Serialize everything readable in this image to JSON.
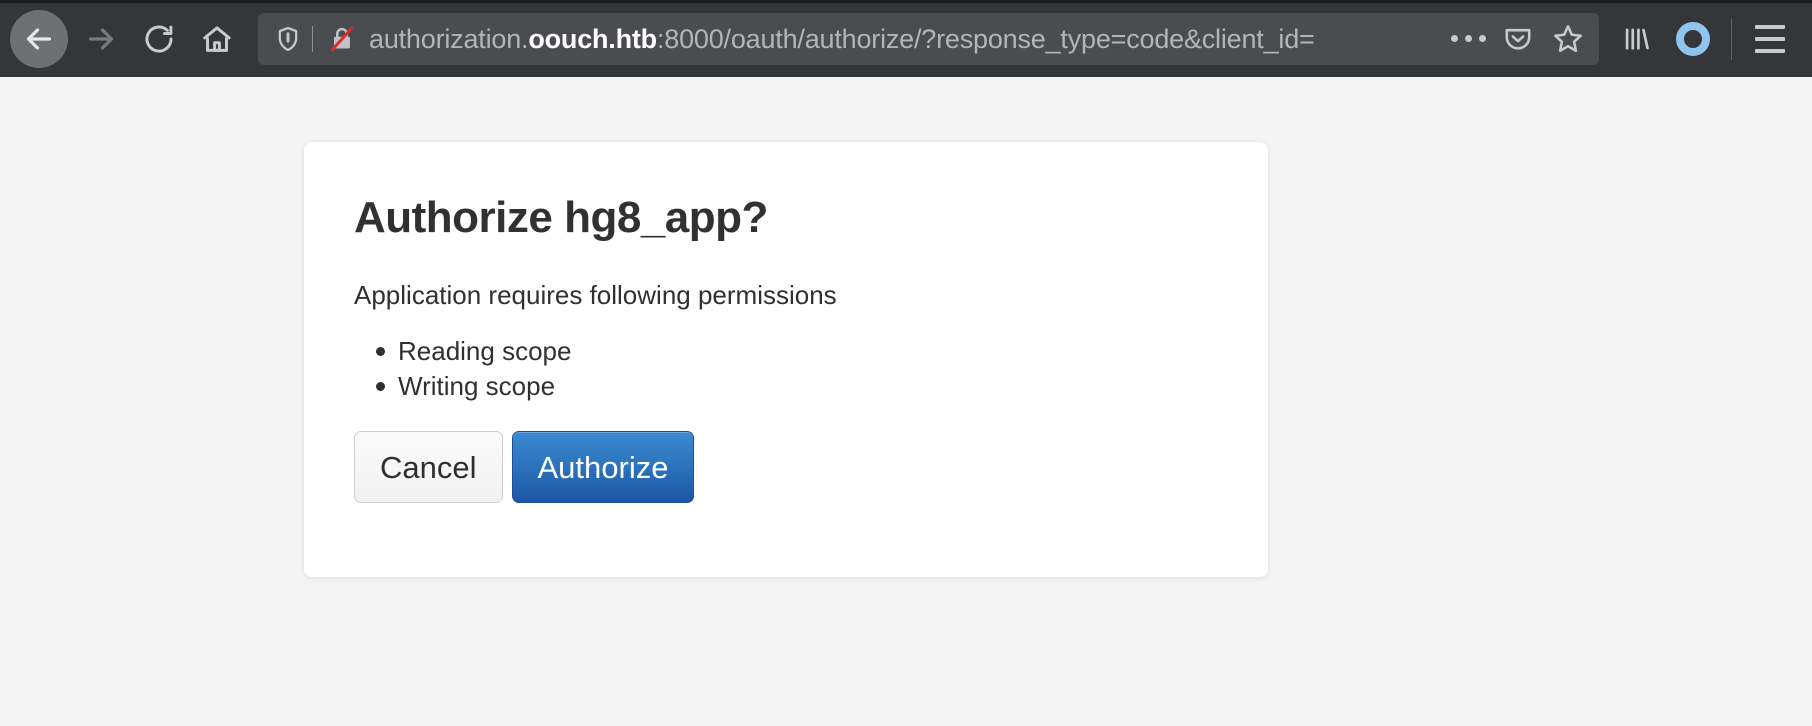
{
  "browser": {
    "nav": {
      "back_label": "Back",
      "forward_label": "Forward",
      "reload_label": "Reload",
      "home_label": "Home"
    },
    "urlbar": {
      "prefix": "authorization.",
      "host": "oouch.htb",
      "suffix": ":8000/oauth/authorize/?response_type=code&client_id=",
      "truncated": true,
      "shield_icon": "shield-icon",
      "lock_icon": "lock-crossed-insecure-icon",
      "page_actions_icon": "ellipsis-icon",
      "pocket_icon": "pocket-icon",
      "bookmark_icon": "star-icon"
    },
    "toolbar": {
      "library_icon": "library-icon",
      "account_icon": "account-circle-icon",
      "menu_icon": "hamburger-menu-icon"
    }
  },
  "page": {
    "title": "Authorize hg8_app?",
    "lead": "Application requires following permissions",
    "scopes": [
      "Reading scope",
      "Writing scope"
    ],
    "buttons": {
      "cancel": "Cancel",
      "authorize": "Authorize"
    }
  },
  "colors": {
    "chrome_bg": "#343639",
    "urlbar_bg": "#4a4c50",
    "page_bg": "#f4f4f4",
    "card_bg": "#ffffff",
    "primary_button": "#2c74bd",
    "account_accent": "#8fc4ee",
    "insecure_slash": "#e02b2b"
  }
}
